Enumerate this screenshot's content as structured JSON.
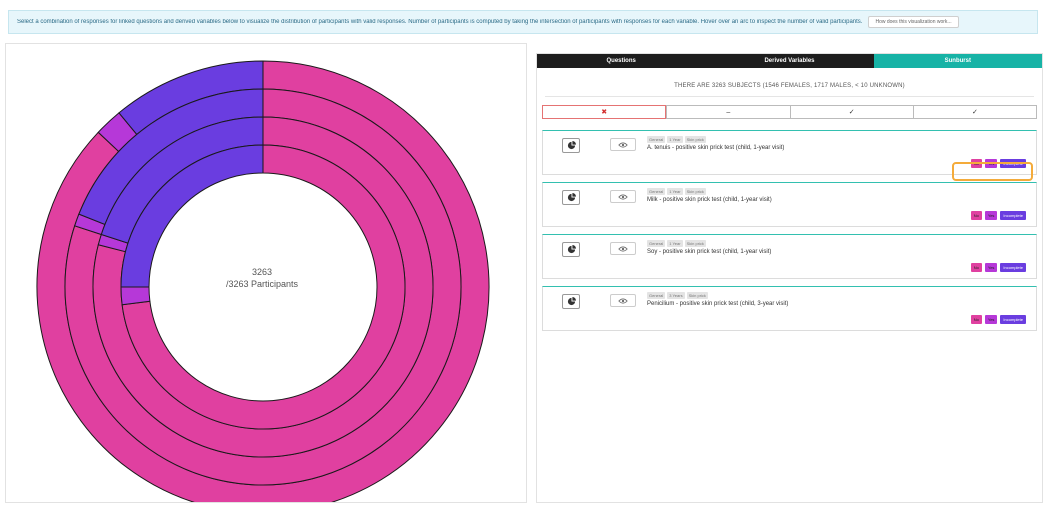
{
  "info": {
    "text": "Select a combination of responses for linked questions and derived variables below to visualize the distribution of participants with valid responses. Number of participants is computed by taking the intersection of participants with responses for each variable. Hover over an arc to inspect the number of valid participants.",
    "help_label": "How does this visualization work..."
  },
  "center": {
    "count": "3263",
    "total": "/3263 Participants"
  },
  "tabs": [
    {
      "label": "Questions"
    },
    {
      "label": "Derived Variables"
    },
    {
      "label": "Sunburst"
    }
  ],
  "subjects_text": "THERE ARE 3263 SUBJECTS (1546 FEMALES, 1717 MALES, < 10 UNKNOWN)",
  "filters": [
    {
      "label": "✖"
    },
    {
      "label": "–"
    },
    {
      "label": "✓"
    },
    {
      "label": "✓"
    }
  ],
  "cards": [
    {
      "tags": [
        "General",
        "1 Year",
        "Skin prick"
      ],
      "title": "A. tenuis - positive skin prick test (child, 1-year visit)",
      "resp": [
        "No",
        "Yes",
        "Incomplete"
      ]
    },
    {
      "tags": [
        "General",
        "1 Year",
        "Skin prick"
      ],
      "title": "Milk - positive skin prick test (child, 1-year visit)",
      "resp": [
        "No",
        "Yes",
        "Incomplete"
      ]
    },
    {
      "tags": [
        "General",
        "1 Year",
        "Skin prick"
      ],
      "title": "Soy - positive skin prick test (child, 1-year visit)",
      "resp": [
        "No",
        "Yes",
        "Incomplete"
      ]
    },
    {
      "tags": [
        "General",
        "3 Years",
        "Skin prick"
      ],
      "title": "Penicilium - positive skin prick test (child, 3-year visit)",
      "resp": [
        "No",
        "Yes",
        "Incomplete"
      ]
    }
  ],
  "colors": {
    "no": "#e040a0",
    "yes": "#b638d8",
    "incomplete": "#6a3de0",
    "accent": "#17b3a6",
    "highlight": "#f4ab3a"
  },
  "sunburst": {
    "total": 3263,
    "rings": [
      [
        {
          "c": "no",
          "f": 0.87
        },
        {
          "c": "yes",
          "f": 0.02
        },
        {
          "c": "incomplete",
          "f": 0.11
        }
      ],
      [
        {
          "c": "no",
          "f": 0.8
        },
        {
          "c": "yes",
          "f": 0.01
        },
        {
          "c": "incomplete",
          "f": 0.19
        }
      ],
      [
        {
          "c": "no",
          "f": 0.79
        },
        {
          "c": "yes",
          "f": 0.01
        },
        {
          "c": "incomplete",
          "f": 0.2
        }
      ],
      [
        {
          "c": "no",
          "f": 0.73
        },
        {
          "c": "yes",
          "f": 0.02
        },
        {
          "c": "incomplete",
          "f": 0.25
        }
      ]
    ]
  }
}
